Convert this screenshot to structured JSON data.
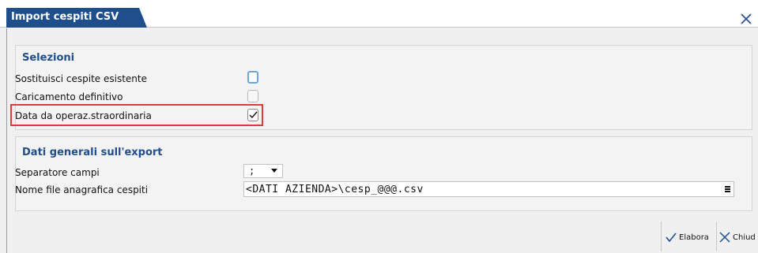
{
  "dialog": {
    "title": "Import cespiti CSV"
  },
  "selezioni": {
    "title": "Selezioni",
    "rows": [
      {
        "label": "Sostituisci cespite esistente",
        "checked": false
      },
      {
        "label": "Caricamento definitivo",
        "checked": false
      },
      {
        "label": "Data da operaz.straordinaria",
        "checked": true
      }
    ]
  },
  "export": {
    "title": "Dati generali sull'export",
    "separatore_label": "Separatore campi",
    "separatore_value": ";",
    "nome_file_label": "Nome file anagrafica cespiti",
    "nome_file_value": "<DATI AZIENDA>\\cesp_@@@.csv"
  },
  "buttons": {
    "elabora": "Elabora",
    "chiudi": "Chiud"
  },
  "colors": {
    "accent": "#1f4e8c",
    "highlight": "#e03a3a"
  }
}
